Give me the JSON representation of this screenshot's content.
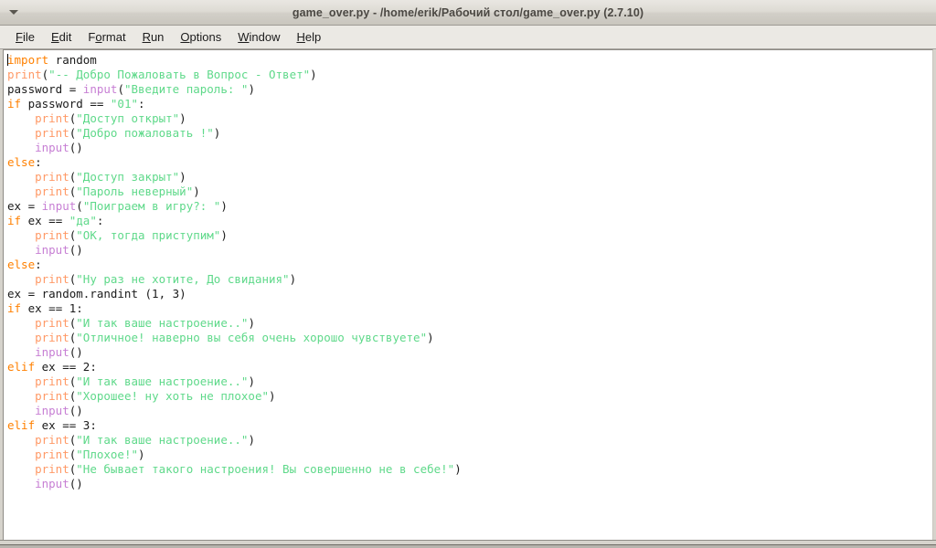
{
  "window": {
    "title": "game_over.py - /home/erik/Рабочий стол/game_over.py (2.7.10)",
    "menu_button_icon": "chevron-down-icon"
  },
  "menubar": {
    "items": [
      {
        "label": "File",
        "mnemonic": "F",
        "rest": "ile"
      },
      {
        "label": "Edit",
        "mnemonic": "E",
        "rest": "dit"
      },
      {
        "label": "Format",
        "pre": "F",
        "mnemonic": "o",
        "rest": "rmat"
      },
      {
        "label": "Run",
        "mnemonic": "R",
        "rest": "un"
      },
      {
        "label": "Options",
        "mnemonic": "O",
        "rest": "ptions"
      },
      {
        "label": "Window",
        "mnemonic": "W",
        "rest": "indow"
      },
      {
        "label": "Help",
        "mnemonic": "H",
        "rest": "elp"
      }
    ]
  },
  "colors": {
    "keyword": "#ff8000",
    "builtin": "#ff9966",
    "function": "#c77fd4",
    "string": "#5fd98a",
    "plain": "#1a1a1a",
    "editor_background": "#ffffff",
    "chrome": "#d6d3cc",
    "titlebar_text": "#4b4843"
  },
  "editor": {
    "caret_line": 1,
    "caret_column": 1,
    "lines": [
      {
        "n": 1,
        "text": "import random"
      },
      {
        "n": 2,
        "text": "print(\"-- Добро Пожаловать в Вопрос - Ответ\")"
      },
      {
        "n": 3,
        "text": "password = input(\"Введите пароль: \")"
      },
      {
        "n": 4,
        "text": "if password == \"01\":"
      },
      {
        "n": 5,
        "text": "    print(\"Доступ открыт\")"
      },
      {
        "n": 6,
        "text": "    print(\"Добро пожаловать !\")"
      },
      {
        "n": 7,
        "text": "    input()"
      },
      {
        "n": 8,
        "text": "else:"
      },
      {
        "n": 9,
        "text": "    print(\"Доступ закрыт\")"
      },
      {
        "n": 10,
        "text": "    print(\"Пароль неверный\")"
      },
      {
        "n": 11,
        "text": "ex = input(\"Поиграем в игру?: \")"
      },
      {
        "n": 12,
        "text": "if ex == \"да\":"
      },
      {
        "n": 13,
        "text": "    print(\"ОК, тогда приступим\")"
      },
      {
        "n": 14,
        "text": "    input()"
      },
      {
        "n": 15,
        "text": "else:"
      },
      {
        "n": 16,
        "text": "    print(\"Ну раз не хотите, До свидания\")"
      },
      {
        "n": 17,
        "text": "ex = random.randint (1, 3)"
      },
      {
        "n": 18,
        "text": "if ex == 1:"
      },
      {
        "n": 19,
        "text": "    print(\"И так ваше настроение..\")"
      },
      {
        "n": 20,
        "text": "    print(\"Отличное! наверно вы себя очень хорошо чувствуете\")"
      },
      {
        "n": 21,
        "text": "    input()"
      },
      {
        "n": 22,
        "text": "elif ex == 2:"
      },
      {
        "n": 23,
        "text": "    print(\"И так ваше настроение..\")"
      },
      {
        "n": 24,
        "text": "    print(\"Хорошее! ну хоть не плохое\")"
      },
      {
        "n": 25,
        "text": "    input()"
      },
      {
        "n": 26,
        "text": "elif ex == 3:"
      },
      {
        "n": 27,
        "text": "    print(\"И так ваше настроение..\")"
      },
      {
        "n": 28,
        "text": "    print(\"Плохое!\")"
      },
      {
        "n": 29,
        "text": "    print(\"Не бывает такого настроения! Вы совершенно не в себе!\")"
      },
      {
        "n": 30,
        "text": "    input()"
      }
    ],
    "tokens": [
      [
        [
          "kw",
          "import"
        ],
        [
          "pl",
          " random"
        ]
      ],
      [
        [
          "bi",
          "print"
        ],
        [
          "pl",
          "("
        ],
        [
          "str",
          "\"-- Добро Пожаловать в Вопрос - Ответ\""
        ],
        [
          "pl",
          ")"
        ]
      ],
      [
        [
          "pl",
          "password = "
        ],
        [
          "fn",
          "input"
        ],
        [
          "pl",
          "("
        ],
        [
          "str",
          "\"Введите пароль: \""
        ],
        [
          "pl",
          ")"
        ]
      ],
      [
        [
          "kw",
          "if"
        ],
        [
          "pl",
          " password == "
        ],
        [
          "str",
          "\"01\""
        ],
        [
          "pl",
          ":"
        ]
      ],
      [
        [
          "pl",
          "    "
        ],
        [
          "bi",
          "print"
        ],
        [
          "pl",
          "("
        ],
        [
          "str",
          "\"Доступ открыт\""
        ],
        [
          "pl",
          ")"
        ]
      ],
      [
        [
          "pl",
          "    "
        ],
        [
          "bi",
          "print"
        ],
        [
          "pl",
          "("
        ],
        [
          "str",
          "\"Добро пожаловать !\""
        ],
        [
          "pl",
          ")"
        ]
      ],
      [
        [
          "pl",
          "    "
        ],
        [
          "fn",
          "input"
        ],
        [
          "pl",
          "()"
        ]
      ],
      [
        [
          "kw",
          "else"
        ],
        [
          "pl",
          ":"
        ]
      ],
      [
        [
          "pl",
          "    "
        ],
        [
          "bi",
          "print"
        ],
        [
          "pl",
          "("
        ],
        [
          "str",
          "\"Доступ закрыт\""
        ],
        [
          "pl",
          ")"
        ]
      ],
      [
        [
          "pl",
          "    "
        ],
        [
          "bi",
          "print"
        ],
        [
          "pl",
          "("
        ],
        [
          "str",
          "\"Пароль неверный\""
        ],
        [
          "pl",
          ")"
        ]
      ],
      [
        [
          "pl",
          "ex = "
        ],
        [
          "fn",
          "input"
        ],
        [
          "pl",
          "("
        ],
        [
          "str",
          "\"Поиграем в игру?: \""
        ],
        [
          "pl",
          ")"
        ]
      ],
      [
        [
          "kw",
          "if"
        ],
        [
          "pl",
          " ex == "
        ],
        [
          "str",
          "\"да\""
        ],
        [
          "pl",
          ":"
        ]
      ],
      [
        [
          "pl",
          "    "
        ],
        [
          "bi",
          "print"
        ],
        [
          "pl",
          "("
        ],
        [
          "str",
          "\"ОК, тогда приступим\""
        ],
        [
          "pl",
          ")"
        ]
      ],
      [
        [
          "pl",
          "    "
        ],
        [
          "fn",
          "input"
        ],
        [
          "pl",
          "()"
        ]
      ],
      [
        [
          "kw",
          "else"
        ],
        [
          "pl",
          ":"
        ]
      ],
      [
        [
          "pl",
          "    "
        ],
        [
          "bi",
          "print"
        ],
        [
          "pl",
          "("
        ],
        [
          "str",
          "\"Ну раз не хотите, До свидания\""
        ],
        [
          "pl",
          ")"
        ]
      ],
      [
        [
          "pl",
          "ex = random.randint (1, 3)"
        ]
      ],
      [
        [
          "kw",
          "if"
        ],
        [
          "pl",
          " ex == 1:"
        ]
      ],
      [
        [
          "pl",
          "    "
        ],
        [
          "bi",
          "print"
        ],
        [
          "pl",
          "("
        ],
        [
          "str",
          "\"И так ваше настроение..\""
        ],
        [
          "pl",
          ")"
        ]
      ],
      [
        [
          "pl",
          "    "
        ],
        [
          "bi",
          "print"
        ],
        [
          "pl",
          "("
        ],
        [
          "str",
          "\"Отличное! наверно вы себя очень хорошо чувствуете\""
        ],
        [
          "pl",
          ")"
        ]
      ],
      [
        [
          "pl",
          "    "
        ],
        [
          "fn",
          "input"
        ],
        [
          "pl",
          "()"
        ]
      ],
      [
        [
          "kw",
          "elif"
        ],
        [
          "pl",
          " ex == 2:"
        ]
      ],
      [
        [
          "pl",
          "    "
        ],
        [
          "bi",
          "print"
        ],
        [
          "pl",
          "("
        ],
        [
          "str",
          "\"И так ваше настроение..\""
        ],
        [
          "pl",
          ")"
        ]
      ],
      [
        [
          "pl",
          "    "
        ],
        [
          "bi",
          "print"
        ],
        [
          "pl",
          "("
        ],
        [
          "str",
          "\"Хорошее! ну хоть не плохое\""
        ],
        [
          "pl",
          ")"
        ]
      ],
      [
        [
          "pl",
          "    "
        ],
        [
          "fn",
          "input"
        ],
        [
          "pl",
          "()"
        ]
      ],
      [
        [
          "kw",
          "elif"
        ],
        [
          "pl",
          " ex == 3:"
        ]
      ],
      [
        [
          "pl",
          "    "
        ],
        [
          "bi",
          "print"
        ],
        [
          "pl",
          "("
        ],
        [
          "str",
          "\"И так ваше настроение..\""
        ],
        [
          "pl",
          ")"
        ]
      ],
      [
        [
          "pl",
          "    "
        ],
        [
          "bi",
          "print"
        ],
        [
          "pl",
          "("
        ],
        [
          "str",
          "\"Плохое!\""
        ],
        [
          "pl",
          ")"
        ]
      ],
      [
        [
          "pl",
          "    "
        ],
        [
          "bi",
          "print"
        ],
        [
          "pl",
          "("
        ],
        [
          "str",
          "\"Не бывает такого настроения! Вы совершенно не в себе!\""
        ],
        [
          "pl",
          ")"
        ]
      ],
      [
        [
          "pl",
          "    "
        ],
        [
          "fn",
          "input"
        ],
        [
          "pl",
          "()"
        ]
      ]
    ]
  }
}
